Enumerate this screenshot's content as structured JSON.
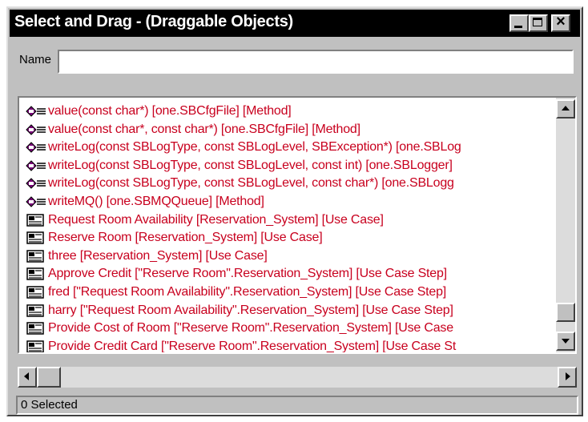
{
  "window": {
    "title": "Select and Drag - (Draggable Objects)"
  },
  "name_field": {
    "label": "Name",
    "value": ""
  },
  "list": {
    "items": [
      {
        "icon": "method-icon",
        "text": "value(const char*) [one.SBCfgFile]  [Method]"
      },
      {
        "icon": "method-icon",
        "text": "value(const char*, const char*) [one.SBCfgFile]  [Method]"
      },
      {
        "icon": "method-icon",
        "text": "writeLog(const SBLogType, const SBLogLevel, SBException*) [one.SBLog"
      },
      {
        "icon": "method-icon",
        "text": "writeLog(const SBLogType, const SBLogLevel, const int) [one.SBLogger]"
      },
      {
        "icon": "method-icon",
        "text": "writeLog(const SBLogType, const SBLogLevel, const char*) [one.SBLogg"
      },
      {
        "icon": "method-icon",
        "text": "writeMQ() [one.SBMQQueue]  [Method]"
      },
      {
        "icon": "use-case-icon",
        "text": "Request Room Availability [Reservation_System]  [Use Case]"
      },
      {
        "icon": "use-case-icon",
        "text": "Reserve Room [Reservation_System]  [Use Case]"
      },
      {
        "icon": "use-case-icon",
        "text": "three [Reservation_System]  [Use Case]"
      },
      {
        "icon": "use-case-icon",
        "text": "Approve Credit [\"Reserve Room\".Reservation_System]  [Use Case Step]"
      },
      {
        "icon": "use-case-icon",
        "text": "fred [\"Request Room Availability\".Reservation_System]  [Use Case Step]"
      },
      {
        "icon": "use-case-icon",
        "text": "harry [\"Request Room Availability\".Reservation_System]  [Use Case Step]"
      },
      {
        "icon": "use-case-icon",
        "text": "Provide Cost of Room [\"Reserve Room\".Reservation_System]  [Use Case"
      },
      {
        "icon": "use-case-icon",
        "text": "Provide Credit Card [\"Reserve Room\".Reservation_System]  [Use Case St"
      }
    ],
    "text_color": "#c8001e"
  },
  "status": {
    "text": "0 Selected"
  }
}
